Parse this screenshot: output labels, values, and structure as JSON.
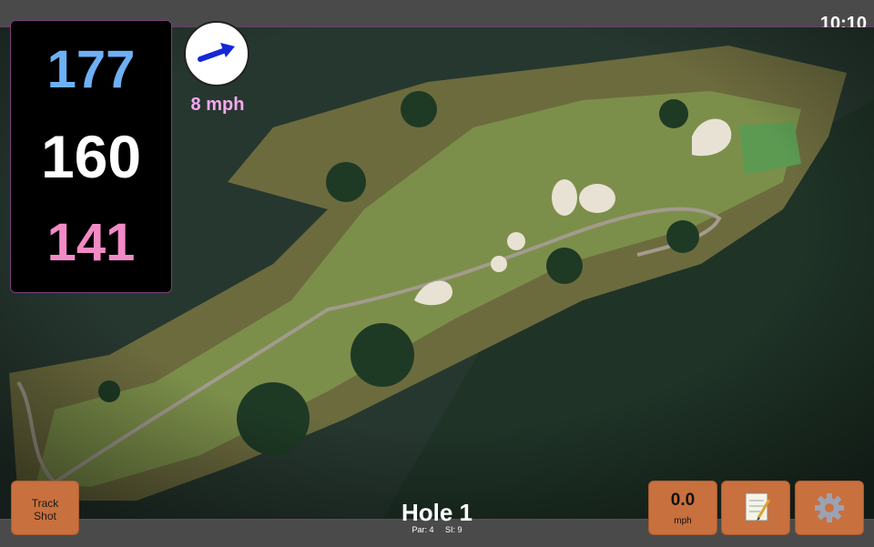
{
  "status": {
    "time": "10:10"
  },
  "distances": {
    "back": "177",
    "middle": "160",
    "front": "141"
  },
  "wind": {
    "speed_label": "8 mph"
  },
  "hole": {
    "title": "Hole 1",
    "par": "Par: 4",
    "si": "SI: 9"
  },
  "buttons": {
    "track_shot": "Track\nShot",
    "speed_value": "0.0",
    "speed_unit": "mph",
    "notes_icon": "notepad-icon",
    "settings_icon": "gear-icon"
  },
  "colors": {
    "distance_back": "#6eb0f5",
    "distance_middle": "#ffffff",
    "distance_front": "#f28ac6",
    "wind_speed": "#f6a8ee",
    "button_bg": "#c8703e",
    "panel_border": "#7a3f7a"
  }
}
